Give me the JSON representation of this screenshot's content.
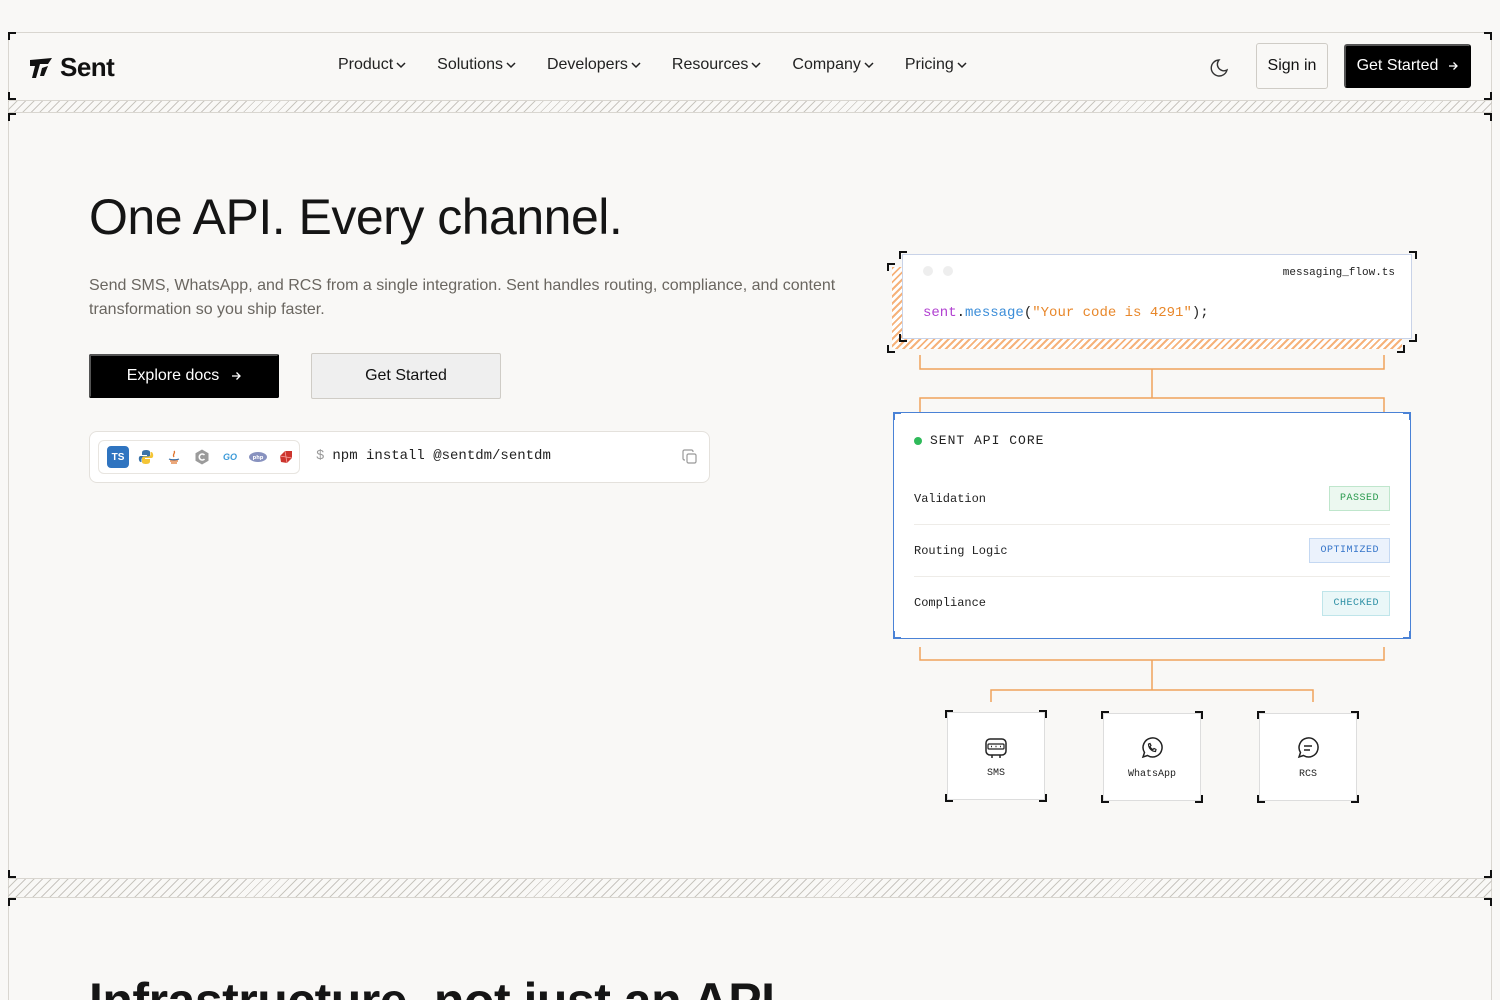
{
  "header": {
    "logo_text": "Sent",
    "nav": [
      {
        "label": "Product"
      },
      {
        "label": "Solutions"
      },
      {
        "label": "Developers"
      },
      {
        "label": "Resources"
      },
      {
        "label": "Company"
      },
      {
        "label": "Pricing"
      }
    ],
    "signin_label": "Sign in",
    "get_started_label": "Get Started"
  },
  "hero": {
    "title": "One API. Every channel.",
    "subtitle": "Send SMS, WhatsApp, and RCS from a single integration. Sent handles routing, compliance, and content transformation so you ship faster.",
    "explore_docs_label": "Explore docs",
    "get_started_label": "Get Started",
    "install": {
      "prompt": "$",
      "command": "npm install @sentdm/sentdm",
      "languages": [
        "TS",
        "Python",
        "Java",
        "C#",
        "GO",
        "PHP",
        "Ruby"
      ]
    }
  },
  "diagram": {
    "code": {
      "filename": "messaging_flow.ts",
      "obj": "sent",
      "dot": ".",
      "fn": "message",
      "open": "(",
      "str": "\"Your code is 4291\"",
      "close": ");"
    },
    "core": {
      "title": "SENT API CORE",
      "rows": [
        {
          "label": "Validation",
          "status": "PASSED"
        },
        {
          "label": "Routing Logic",
          "status": "OPTIMIZED"
        },
        {
          "label": "Compliance",
          "status": "CHECKED"
        }
      ]
    },
    "channels": [
      {
        "label": "SMS",
        "icon": "sms-icon"
      },
      {
        "label": "WhatsApp",
        "icon": "whatsapp-icon"
      },
      {
        "label": "RCS",
        "icon": "rcs-icon"
      }
    ],
    "colors": {
      "connector": "#f0a25c",
      "core_border": "#4a82d6"
    }
  },
  "section2": {
    "title": "Infrastructure, not just an API."
  }
}
